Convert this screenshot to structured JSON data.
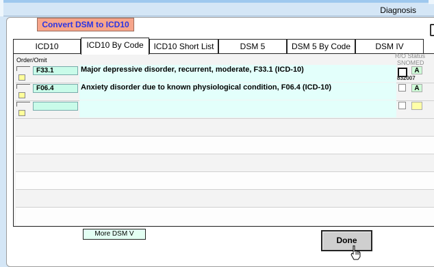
{
  "window": {
    "title": "Diagnosis"
  },
  "toolbar": {
    "convert_label": "Convert DSM to ICD10"
  },
  "tabs": [
    {
      "label": "ICD10"
    },
    {
      "label": "ICD10 By Code"
    },
    {
      "label": "ICD10 Short List"
    },
    {
      "label": "DSM 5"
    },
    {
      "label": "DSM 5 By Code"
    },
    {
      "label": "DSM IV"
    }
  ],
  "active_tab": "ICD10 By Code",
  "grid": {
    "order_omit_header": "Order/Omit",
    "ro_header": "R/O",
    "status_header": "Status",
    "snomed_header": "SNOMED",
    "rows": [
      {
        "code": "F33.1",
        "description": "Major depressive disorder, recurrent, moderate, F33.1 (ICD-10)",
        "status": "A",
        "snomed": "832007"
      },
      {
        "code": "F06.4",
        "description": "Anxiety disorder due to known physiological condition, F06.4 (ICD-10)",
        "status": "A",
        "snomed": ""
      },
      {
        "code": "",
        "description": "",
        "status": "",
        "snomed": ""
      }
    ]
  },
  "buttons": {
    "more_label": "More DSM V",
    "done_label": "Done"
  },
  "colors": {
    "convert_bg": "#f6a58b",
    "convert_text": "#2b34e3",
    "code_bg": "#c9fbe9",
    "desc_bg": "#e3fffb",
    "status_bg": "#cffcd8",
    "omit_bg": "#ffff9a"
  }
}
